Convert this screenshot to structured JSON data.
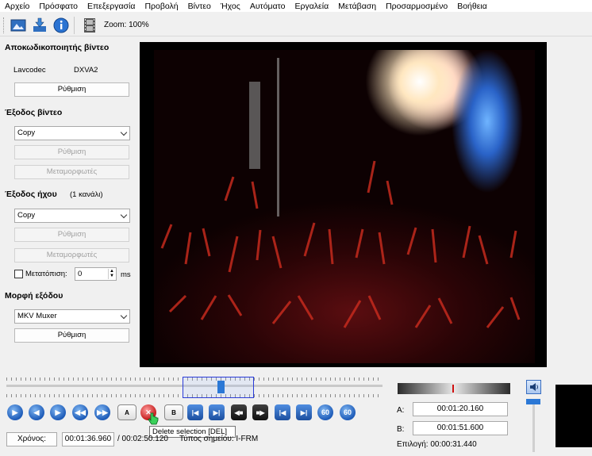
{
  "menu": [
    "Αρχείο",
    "Πρόσφατο",
    "Επεξεργασία",
    "Προβολή",
    "Βίντεο",
    "Ήχος",
    "Αυτόματο",
    "Εργαλεία",
    "Μετάβαση",
    "Προσαρμοσμένο",
    "Βοήθεια"
  ],
  "toolbar": {
    "zoom_label": "Zoom: 100%"
  },
  "video_decoder": {
    "title": "Αποκωδικοποιητής βίντεο",
    "decoder_name": "Lavcodec",
    "decoder_mode": "DXVA2",
    "config_button": "Ρύθμιση"
  },
  "video_output": {
    "title": "Έξοδος βίντεο",
    "codec": "Copy",
    "config_button": "Ρύθμιση",
    "filters_button": "Μεταμορφωτές"
  },
  "audio_output": {
    "title": "Έξοδος ήχου",
    "channels": "(1 κανάλι)",
    "codec": "Copy",
    "config_button": "Ρύθμιση",
    "filters_button": "Μεταμορφωτές",
    "shift_label": "Μετατόπιση:",
    "shift_value": "0",
    "shift_unit": "ms"
  },
  "output_format": {
    "title": "Μορφή εξόδου",
    "muxer": "MKV Muxer",
    "config_button": "Ρύθμιση"
  },
  "timeline": {
    "position_fraction": 0.57
  },
  "transport": {
    "marker_a_label": "A",
    "marker_b_label": "B",
    "jump_60_label": "60"
  },
  "selection": {
    "a_label": "A:",
    "a_time": "00:01:20.160",
    "b_label": "B:",
    "b_time": "00:01:51.600",
    "selection_label": "Επιλογή: 00:00:31.440"
  },
  "status": {
    "time_button": "Χρόνος:",
    "current_time": "00:01:36.960",
    "total_time": "/ 00:02:50.120",
    "frame_type": "Τύπος σημείου: I-FRM"
  },
  "tooltip": "Delete selection [DEL]",
  "colors": {
    "accent_blue": "#2b78d6",
    "selection_border": "#2a3bd8",
    "jog_marker": "#d01010"
  }
}
